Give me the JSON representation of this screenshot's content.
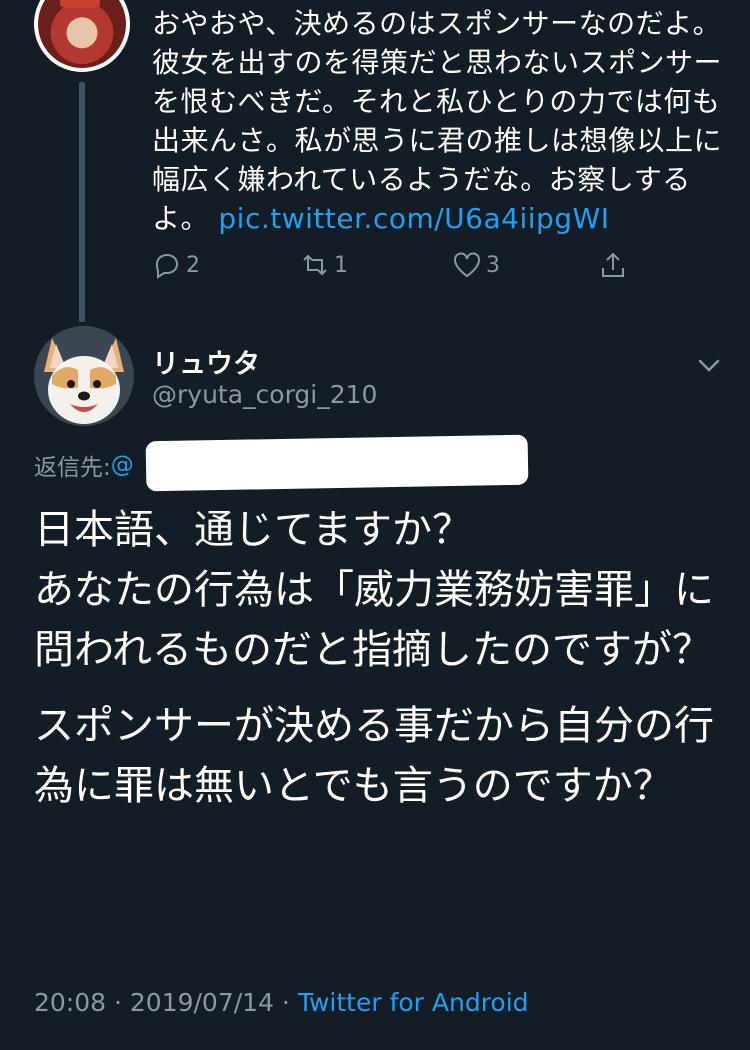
{
  "previous_tweet": {
    "lines": [
      "おやおや、決めるのはスポンサーなのだよ。",
      "彼女を出すのを得策だと思わないスポンサー",
      "を恨むべきだ。それと私ひとりの力では何も",
      "出来んさ。私が思うに君の推しは想像以上に",
      "幅広く嫌われているようだな。お察しする",
      "よ。 "
    ],
    "link": "pic.twitter.com/U6a4iipgWI",
    "reply_count": "2",
    "retweet_count": "1",
    "like_count": "3"
  },
  "tweet": {
    "display_name": "リュウタ",
    "handle": "@ryuta_corgi_210",
    "reply_to_label": "返信先: ",
    "reply_to_mention": "@",
    "paragraphs": [
      "日本語、通じてますか？\nあなたの行為は「威力業務妨害罪」に問われるものだと指摘したのですが？",
      "スポンサーが決める事だから自分の行為に罪は無いとでも言うのですか？"
    ],
    "timestamp": "20:08 · 2019/07/14 · ",
    "source": "Twitter for Android"
  },
  "colors": {
    "background": "#141d26",
    "text": "#ffffff",
    "muted": "#8899a6",
    "accent": "#1da1f2"
  },
  "icons": [
    "reply-icon",
    "retweet-icon",
    "like-icon",
    "share-icon",
    "chevron-down-icon"
  ]
}
